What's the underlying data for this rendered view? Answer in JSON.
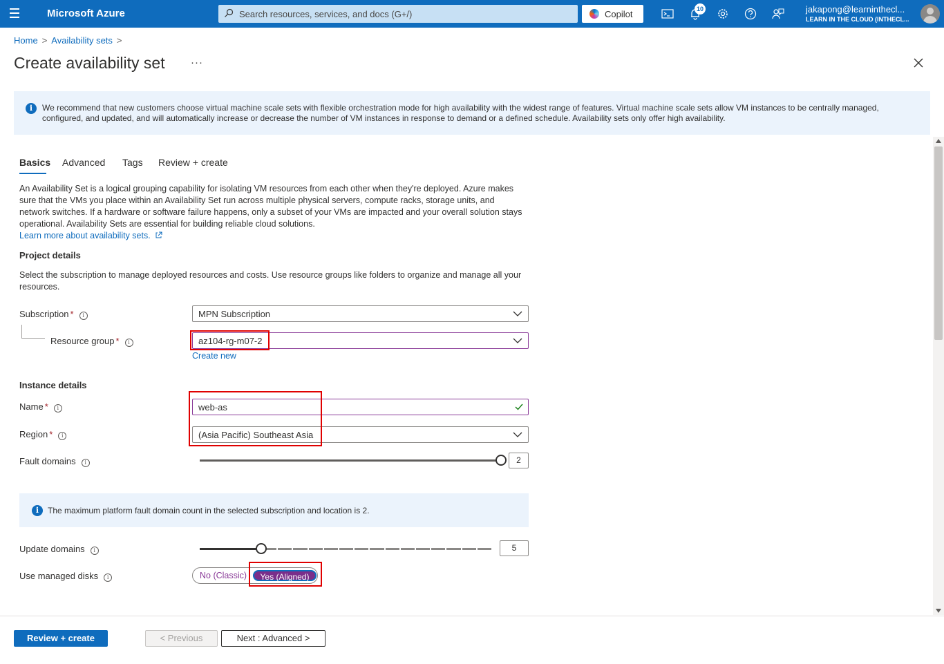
{
  "topbar": {
    "brand": "Microsoft Azure",
    "search_placeholder": "Search resources, services, and docs (G+/)",
    "copilot_label": "Copilot",
    "notification_count": "10",
    "user_name": "jakapong@learninthecl...",
    "user_tenant": "LEARN IN THE CLOUD (INTHECL..."
  },
  "breadcrumb": {
    "home": "Home",
    "parent": "Availability sets",
    "separator": ">"
  },
  "page": {
    "title": "Create availability set",
    "more": "···"
  },
  "banner": {
    "text": "We recommend that new customers choose virtual machine scale sets with flexible orchestration mode for high availability with the widest range of features. Virtual machine scale sets allow VM instances to be centrally managed, configured, and updated, and will automatically increase or decrease the number of VM instances in response to demand or a defined schedule. Availability sets only offer high availability."
  },
  "tabs": [
    "Basics",
    "Advanced",
    "Tags",
    "Review + create"
  ],
  "basics": {
    "description": "An Availability Set is a logical grouping capability for isolating VM resources from each other when they're deployed. Azure makes sure that the VMs you place within an Availability Set run across multiple physical servers, compute racks, storage units, and network switches. If a hardware or software failure happens, only a subset of your VMs are impacted and your overall solution stays operational. Availability Sets are essential for building reliable cloud solutions.",
    "learn_more": "Learn more about availability sets.",
    "project_details_heading": "Project details",
    "project_details_desc": "Select the subscription to manage deployed resources and costs. Use resource groups like folders to organize and manage all your resources.",
    "subscription_label": "Subscription",
    "subscription_value": "MPN Subscription",
    "resource_group_label": "Resource group",
    "resource_group_value": "az104-rg-m07-2",
    "create_new": "Create new",
    "instance_details_heading": "Instance details",
    "name_label": "Name",
    "name_value": "web-as",
    "region_label": "Region",
    "region_value": "(Asia Pacific) Southeast Asia",
    "fault_domains_label": "Fault domains",
    "fault_domains_value": "2",
    "fault_domains_level": 1.0,
    "fault_note": "The maximum platform fault domain count in the selected subscription and location is 2.",
    "update_domains_label": "Update domains",
    "update_domains_value": "5",
    "update_domains_level": 0.2,
    "managed_disks_label": "Use managed disks",
    "managed_disks_no": "No (Classic)",
    "managed_disks_yes": "Yes (Aligned)",
    "required_mark": "*",
    "info_mark": "i"
  },
  "footer": {
    "review_create": "Review + create",
    "previous": "< Previous",
    "next": "Next : Advanced >"
  },
  "colors": {
    "azure_blue": "#0f6cbd",
    "highlight_red": "#e00000",
    "toggle_purple": "#7a2e8a"
  }
}
